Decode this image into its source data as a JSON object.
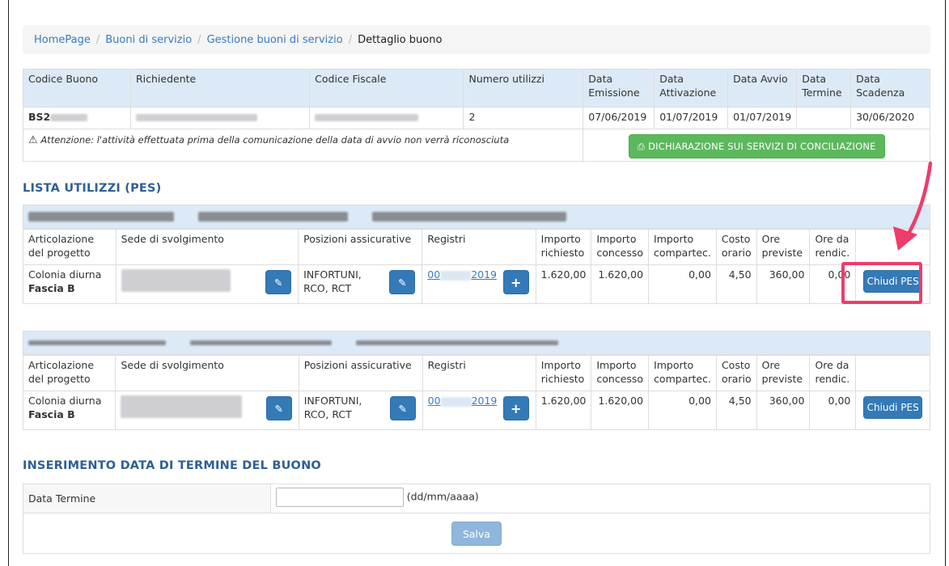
{
  "breadcrumb": {
    "items": [
      "HomePage",
      "Buoni di servizio",
      "Gestione buoni di servizio"
    ],
    "current": "Dettaglio buono",
    "separator": "/"
  },
  "voucher": {
    "headers": [
      "Codice Buono",
      "Richiedente",
      "Codice Fiscale",
      "Numero utilizzi",
      "Data Emissione",
      "Data Attivazione",
      "Data Avvio",
      "Data Termine",
      "Data Scadenza"
    ],
    "row": {
      "codice_buono": "BS2",
      "numero_utilizzi": "2",
      "data_emissione": "07/06/2019",
      "data_attivazione": "01/07/2019",
      "data_avvio": "01/07/2019",
      "data_termine": "",
      "data_scadenza": "30/06/2020"
    },
    "warning": "Attenzione: l'attività effettuata prima della comunicazione della data di avvio non verrà riconosciuta",
    "declaration_button": "DICHIARAZIONE SUI SERVIZI DI CONCILIAZIONE"
  },
  "pes_section_title": "LISTA UTILIZZI (PES)",
  "pes_headers": [
    "Articolazione del progetto",
    "Sede di svolgimento",
    "Posizioni assicurative",
    "Registri",
    "Importo richiesto",
    "Importo concesso",
    "Importo compartec.",
    "Costo orario",
    "Ore previste",
    "Ore da rendic."
  ],
  "pes": [
    {
      "articolazione": "Colonia diurna",
      "fascia": "Fascia B",
      "posizioni": "INFORTUNI, RCO, RCT",
      "registro_prefix": "00",
      "registro_suffix": "2019",
      "importo_richiesto": "1.620,00",
      "importo_concesso": "1.620,00",
      "importo_compartec": "0,00",
      "costo_orario": "4,50",
      "ore_previste": "360,00",
      "ore_rendic": "0,00",
      "close_button": "Chiudi PES"
    },
    {
      "articolazione": "Colonia diurna",
      "fascia": "Fascia B",
      "posizioni": "INFORTUNI, RCO, RCT",
      "registro_prefix": "00",
      "registro_suffix": "2019",
      "importo_richiesto": "1.620,00",
      "importo_concesso": "1.620,00",
      "importo_compartec": "0,00",
      "costo_orario": "4,50",
      "ore_previste": "360,00",
      "ore_rendic": "0,00",
      "close_button": "Chiudi PES"
    }
  ],
  "end_date_section": {
    "title": "INSERIMENTO DATA DI TERMINE DEL BUONO",
    "label": "Data Termine",
    "input_value": "",
    "format_hint": "(dd/mm/aaaa)",
    "save_button": "Salva"
  },
  "colors": {
    "accent_blue": "#337ab7",
    "green": "#5cb85c",
    "highlight_pink": "#ee3c6b",
    "section_title": "#2f5f93"
  }
}
